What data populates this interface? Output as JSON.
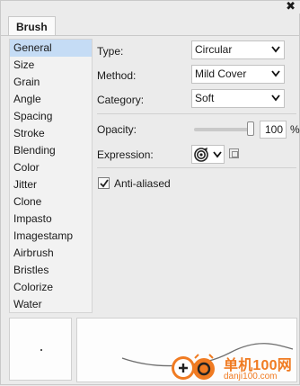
{
  "panel": {
    "close_glyph": "✖",
    "tab_label": "Brush"
  },
  "categories": [
    {
      "label": "General",
      "selected": true
    },
    {
      "label": "Size"
    },
    {
      "label": "Grain"
    },
    {
      "label": "Angle"
    },
    {
      "label": "Spacing"
    },
    {
      "label": "Stroke"
    },
    {
      "label": "Blending"
    },
    {
      "label": "Color"
    },
    {
      "label": "Jitter"
    },
    {
      "label": "Clone"
    },
    {
      "label": "Impasto"
    },
    {
      "label": "Imagestamp"
    },
    {
      "label": "Airbrush"
    },
    {
      "label": "Bristles"
    },
    {
      "label": "Colorize"
    },
    {
      "label": "Water"
    }
  ],
  "general": {
    "type_label": "Type:",
    "type_value": "Circular",
    "method_label": "Method:",
    "method_value": "Mild Cover",
    "category_label": "Category:",
    "category_value": "Soft",
    "opacity_label": "Opacity:",
    "opacity_value": "100",
    "opacity_unit": "%",
    "opacity_fraction": 1.0,
    "expression_label": "Expression:",
    "expression_icon": "target-pressure-icon",
    "antialiased_label": "Anti-aliased",
    "antialiased_checked": true
  },
  "watermark": {
    "name": "单机100网",
    "url": "danji100.com"
  },
  "colors": {
    "selected_bg": "#c5dcf5",
    "watermark": "#f07b22"
  }
}
